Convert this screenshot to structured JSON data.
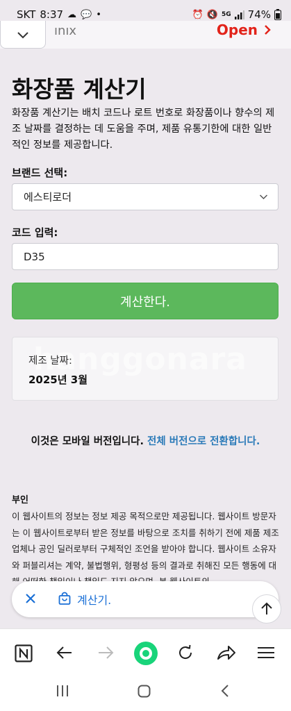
{
  "status": {
    "carrier": "SKT",
    "time": "8:37",
    "network": "5G",
    "battery": "74%"
  },
  "banner": {
    "brand_partial": "ınıx",
    "open_label": "Open"
  },
  "page": {
    "title": "화장품 계산기",
    "intro": "화장품 계산기는 배치 코드나 로트 번호로 화장품이나 향수의 제조 날짜를 결정하는 데 도움을 주며, 제품 유통기한에 대한 일반적인 정보를 제공합니다."
  },
  "form": {
    "brand_label": "브랜드 선택:",
    "brand_value": "에스티로더",
    "code_label": "코드 입력:",
    "code_value": "D35",
    "submit_label": "계산한다."
  },
  "result": {
    "watermark": "hanggonara",
    "label": "제조 날짜:",
    "value": "2025년 3월"
  },
  "mobile_notice": {
    "text": "이것은 모바일 버전입니다.",
    "link": "전체 버전으로 전환합니다."
  },
  "disclaimer": {
    "title": "부인",
    "body": "이 웹사이트의 정보는 정보 제공 목적으로만 제공됩니다. 웹사이트 방문자는 이 웹사이트로부터 받은 정보를 바탕으로 조치를 취하기 전에 제품 제조업체나 공인 딜러로부터 구체적인 조언을 받아야 합니다. 웹사이트 소유자와 퍼블리셔는 계약, 불법행위, 형평성 등의 결과로 취해진 모든 행동에 대해 어떠한 책임이나 책임도 지지 않으며, 본 웹사이트의"
  },
  "floating": {
    "label": "계산기."
  },
  "colors": {
    "accent_green": "#5cb85c",
    "link_blue": "#2a7ab8",
    "open_red": "#e2231a",
    "float_blue": "#1a6fd6",
    "record_green": "#19d47a"
  }
}
